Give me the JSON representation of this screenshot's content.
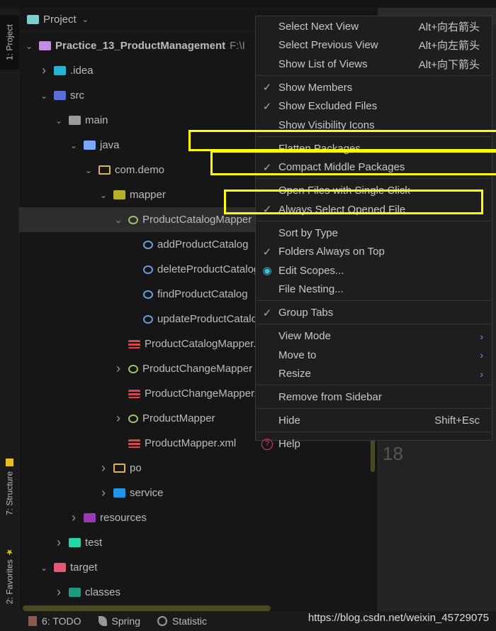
{
  "side_tabs": {
    "project": "1: Project",
    "structure": "7: Structure",
    "favorites": "2: Favorites"
  },
  "panel": {
    "title": "Project"
  },
  "tree": [
    {
      "label": "Practice_13_ProductManagement",
      "path": "F:\\I",
      "depth": 0,
      "expanded": true,
      "icon": "module-folder-icon",
      "color": "#c58ce6",
      "bold": true
    },
    {
      "label": ".idea",
      "depth": 1,
      "expanded": false,
      "icon": "idea-folder-icon",
      "color": "#1fb5d6"
    },
    {
      "label": "src",
      "depth": 1,
      "expanded": true,
      "icon": "source-folder-icon",
      "color": "#5b6fd6"
    },
    {
      "label": "main",
      "depth": 2,
      "expanded": true,
      "icon": "folder-icon",
      "color": "#9a9a9a"
    },
    {
      "label": "java",
      "depth": 3,
      "expanded": true,
      "icon": "java-folder-icon",
      "color": "#7aa7ff"
    },
    {
      "label": "com.demo",
      "depth": 4,
      "expanded": true,
      "icon": "package-icon",
      "color": "#e0b450"
    },
    {
      "label": "mapper",
      "depth": 5,
      "expanded": true,
      "icon": "mapper-package-icon",
      "color": "#b6b02c"
    },
    {
      "label": "ProductCatalogMapper",
      "depth": 6,
      "expanded": true,
      "icon": "interface-icon",
      "color": "#9fc46b",
      "selected": true
    },
    {
      "label": "addProductCatalog",
      "depth": 7,
      "icon": "method-icon",
      "color": "#6a9fe0"
    },
    {
      "label": "deleteProductCatalog",
      "depth": 7,
      "icon": "method-icon",
      "color": "#6a9fe0"
    },
    {
      "label": "findProductCatalog",
      "depth": 7,
      "icon": "method-icon",
      "color": "#6a9fe0"
    },
    {
      "label": "updateProductCatalog",
      "depth": 7,
      "icon": "method-icon",
      "color": "#6a9fe0"
    },
    {
      "label": "ProductCatalogMapper.xml",
      "depth": 6,
      "icon": "mybatis-xml-icon",
      "color": "#d64848"
    },
    {
      "label": "ProductChangeMapper",
      "depth": 6,
      "expanded": false,
      "icon": "interface-icon",
      "color": "#9fc46b"
    },
    {
      "label": "ProductChangeMapper.xml",
      "depth": 6,
      "icon": "mybatis-xml-icon",
      "color": "#d64848"
    },
    {
      "label": "ProductMapper",
      "depth": 6,
      "expanded": false,
      "icon": "interface-icon",
      "color": "#9fc46b"
    },
    {
      "label": "ProductMapper.xml",
      "depth": 6,
      "icon": "mybatis-xml-icon",
      "color": "#d64848"
    },
    {
      "label": "po",
      "depth": 5,
      "expanded": false,
      "icon": "package-icon",
      "color": "#e0b450"
    },
    {
      "label": "service",
      "depth": 5,
      "expanded": false,
      "icon": "service-package-icon",
      "color": "#2196e8"
    },
    {
      "label": "resources",
      "depth": 3,
      "expanded": false,
      "icon": "resources-folder-icon",
      "color": "#9a3ab8"
    },
    {
      "label": "test",
      "depth": 2,
      "expanded": false,
      "icon": "test-folder-icon",
      "color": "#22d6a8"
    },
    {
      "label": "target",
      "depth": 1,
      "expanded": true,
      "icon": "excluded-folder-icon",
      "color": "#e05a70"
    },
    {
      "label": "classes",
      "depth": 2,
      "expanded": false,
      "icon": "classes-folder-icon",
      "color": "#1a9a80"
    }
  ],
  "menu": {
    "groups": [
      [
        {
          "label": "Select Next View",
          "shortcut": "Alt+向右箭头"
        },
        {
          "label": "Select Previous View",
          "shortcut": "Alt+向左箭头"
        },
        {
          "label": "Show List of Views",
          "shortcut": "Alt+向下箭头"
        }
      ],
      [
        {
          "label": "Show Members",
          "checked": true
        },
        {
          "label": "Show Excluded Files",
          "checked": true
        },
        {
          "label": "Show Visibility Icons"
        }
      ],
      [
        {
          "label": "Flatten Packages"
        },
        {
          "label": "Compact Middle Packages",
          "checked": true
        }
      ],
      [
        {
          "label": "Open Files with Single Click"
        },
        {
          "label": "Always Select Opened File",
          "checked": true
        }
      ],
      [
        {
          "label": "Sort by Type"
        },
        {
          "label": "Folders Always on Top",
          "checked": true
        },
        {
          "label": "Edit Scopes...",
          "icon": "scopes-icon"
        },
        {
          "label": "File Nesting..."
        }
      ],
      [
        {
          "label": "Group Tabs",
          "checked": true
        }
      ],
      [
        {
          "label": "View Mode",
          "submenu": true
        },
        {
          "label": "Move to",
          "submenu": true
        },
        {
          "label": "Resize",
          "submenu": true
        }
      ],
      [
        {
          "label": "Remove from Sidebar"
        }
      ],
      [
        {
          "label": "Hide",
          "shortcut": "Shift+Esc"
        }
      ],
      [
        {
          "label": "Help",
          "icon": "help-icon"
        }
      ]
    ]
  },
  "highlight_color": "#ffff00",
  "editor": {
    "line_number": "18"
  },
  "bottom": {
    "todo": "6: TODO",
    "spring": "Spring",
    "statistic": "Statistic"
  },
  "watermark": "https://blog.csdn.net/weixin_45729075"
}
